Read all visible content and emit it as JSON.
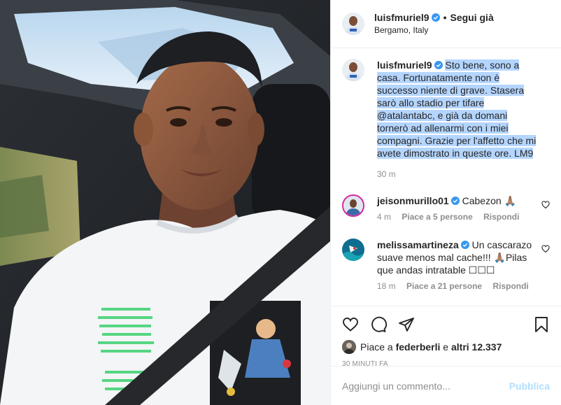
{
  "post": {
    "author": "luisfmuriel9",
    "separator": "•",
    "follow_label": "Segui già",
    "location": "Bergamo, Italy"
  },
  "caption": {
    "author": "luisfmuriel9",
    "text": "Sto bene, sono a casa. Fortunatamente non è successo niente di grave. Stasera sarò allo stadio per tifare @atalantabc, e già da domani tornerò ad allenarmi con i miei compagni. Grazie per l'affetto che mi avete dimostrato in queste ore. LM9",
    "time": "30 m"
  },
  "comments": [
    {
      "author": "jeisonmurillo01",
      "text": "Cabezon 🙏🏽",
      "time": "4 m",
      "likes": "Piace a 5 persone",
      "reply": "Rispondi"
    },
    {
      "author": "melissamartineza",
      "text": "Un cascarazo suave menos mal cache!!! 🙏🏽Pilas que andas intratable ☐☐☐",
      "time": "18 m",
      "likes": "Piace a 21 persone",
      "reply": "Rispondi"
    }
  ],
  "likes": {
    "prefix": "Piace a",
    "first_user": "federberli",
    "conjunction": "e",
    "others": "altri 12.337"
  },
  "timestamp": "30 MINUTI FA",
  "add_comment": {
    "placeholder": "Aggiungi un commento...",
    "publish_label": "Pubblica"
  },
  "icons": {
    "heart": "heart-icon",
    "comment": "comment-icon",
    "share": "share-icon",
    "save": "bookmark-icon",
    "verified": "verified-icon"
  },
  "colors": {
    "verified": "#3897f0",
    "muted": "#8e8e8e",
    "selection": "#b4d5fe",
    "publish_disabled": "#b2dffc"
  }
}
